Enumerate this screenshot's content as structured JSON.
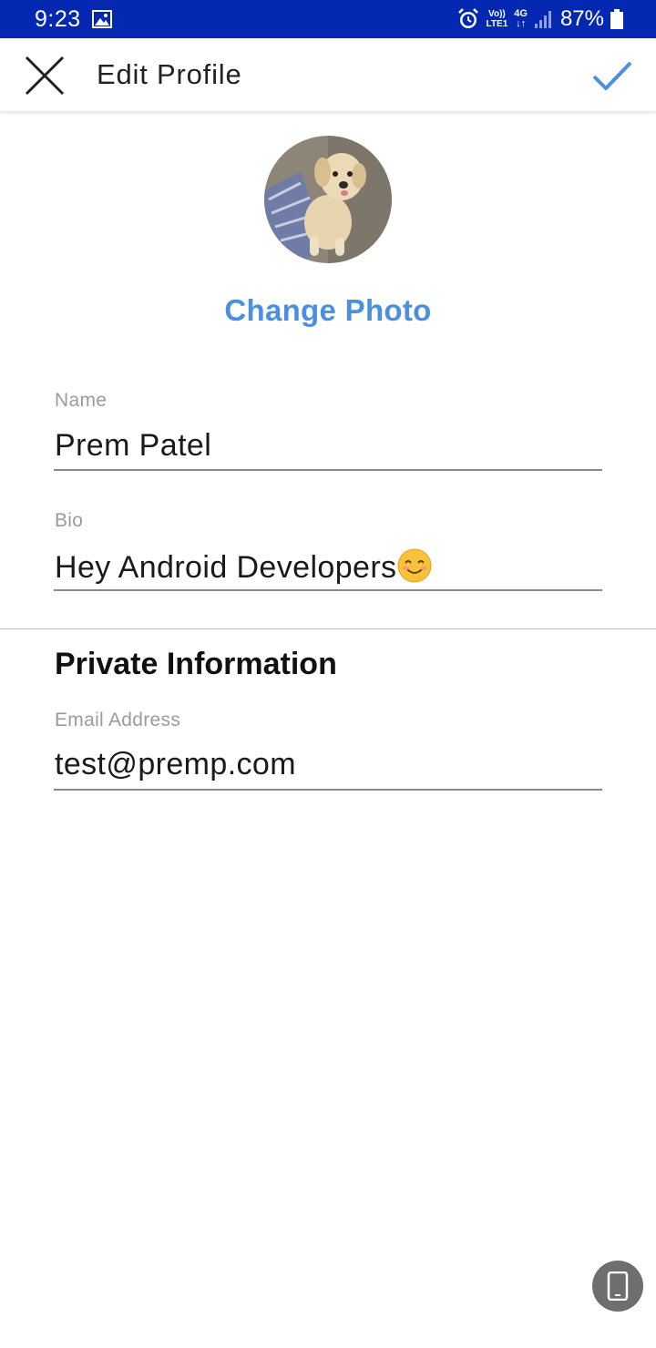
{
  "status_bar": {
    "time": "9:23",
    "volte_top": "Vo))",
    "volte_bottom": "LTE1",
    "network": "4G",
    "network_arrows": "↓↑",
    "battery": "87%",
    "icons": [
      "gallery-icon",
      "alarm-icon",
      "signal-icon",
      "battery-icon"
    ],
    "background": "#0528b3"
  },
  "app_bar": {
    "title": "Edit Profile",
    "close_icon": "close-icon",
    "confirm_icon": "check-icon",
    "accent": "#4a8fe0"
  },
  "profile": {
    "avatar": "dog-photo",
    "change_photo_label": "Change Photo"
  },
  "fields": {
    "name": {
      "label": "Name",
      "value": "Prem Patel"
    },
    "bio": {
      "label": "Bio",
      "value": "Hey Android Developers"
    },
    "email": {
      "label": "Email Address",
      "value": "test@premp.com"
    }
  },
  "sections": {
    "private_title": "Private Information"
  },
  "floating_button": {
    "icon": "phone-icon"
  }
}
